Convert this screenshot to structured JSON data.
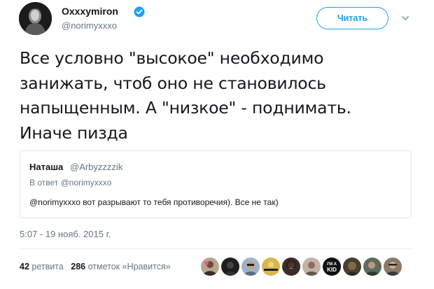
{
  "author": {
    "name": "Oxxxymiron",
    "handle": "@norimyxxxo",
    "verified": true
  },
  "follow_button": {
    "label": "Читать"
  },
  "menu": {
    "icon": "chevron-down-icon"
  },
  "tweet": {
    "text": "Все условно \"высокое\" необходимо\nзанижать, чтоб оно не становилось\nнапыщенным. А \"низкое\" - поднимать.\nИначе пизда"
  },
  "quoted_tweet": {
    "author_name": "Наташа",
    "author_handle": "@Arbyzzzzik",
    "reply_prefix": "В ответ",
    "reply_to": "@norimyxxxo",
    "text": "@norimyxxxo вот разрывают то тебя противоречия). Все не так)"
  },
  "timestamp": "5:07 - 19 нояб. 2015 г.",
  "stats": {
    "retweets_count": "42",
    "retweets_label": "ретвита",
    "likes_count": "286",
    "likes_label": "отметок «Нравится»"
  },
  "likers": [
    "avatar-1",
    "avatar-2",
    "avatar-3",
    "avatar-4",
    "avatar-5",
    "avatar-6",
    "avatar-7",
    "avatar-8",
    "avatar-9",
    "avatar-10"
  ],
  "colors": {
    "accent": "#1da1f2",
    "text": "#14171a",
    "secondary": "#657786",
    "border": "#e1e8ed"
  }
}
